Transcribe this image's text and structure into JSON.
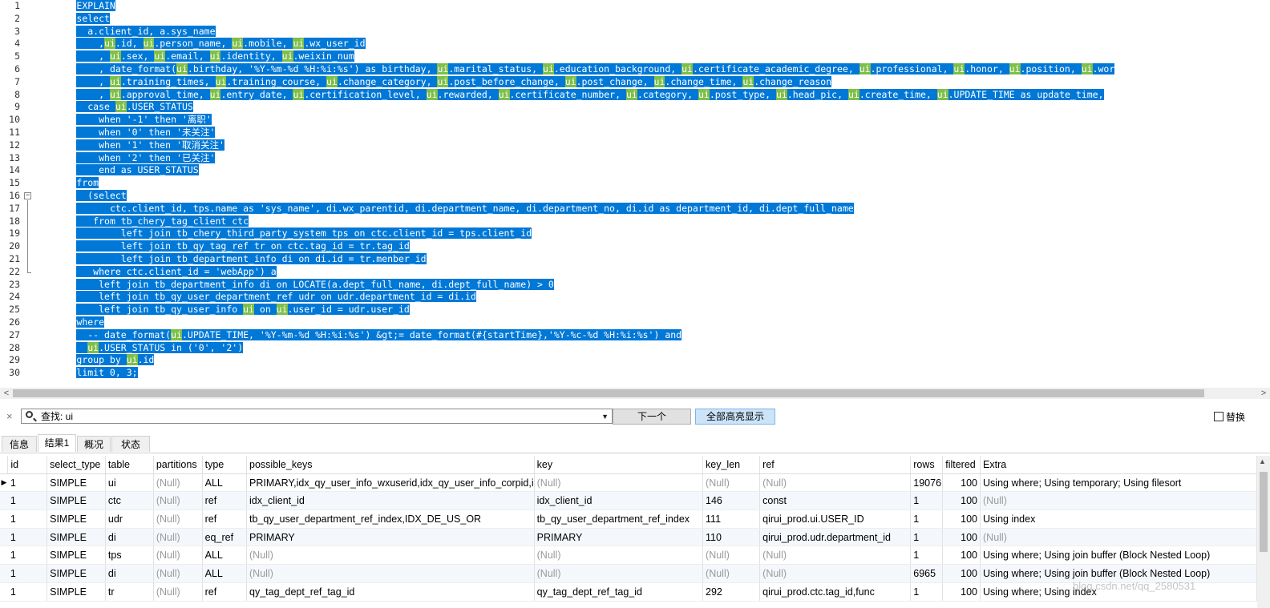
{
  "editor": {
    "line_numbers": [
      "1",
      "2",
      "3",
      "4",
      "5",
      "6",
      "7",
      "8",
      "9",
      "10",
      "11",
      "12",
      "13",
      "14",
      "15",
      "16",
      "17",
      "18",
      "19",
      "20",
      "21",
      "22",
      "23",
      "24",
      "25",
      "26",
      "27",
      "28",
      "29",
      "30"
    ],
    "fold_marker": "−",
    "lines": [
      [
        "        ",
        "EXPLAIN"
      ],
      [
        "        ",
        "select"
      ],
      [
        "          ",
        "a.client_id, a.sys_name"
      ],
      [
        "            ",
        ",",
        "ui",
        ".id, ",
        "ui",
        ".person_name, ",
        "ui",
        ".mobile, ",
        "ui",
        ".wx_user_id"
      ],
      [
        "            ",
        ", ",
        "ui",
        ".sex, ",
        "ui",
        ".email, ",
        "ui",
        ".identity, ",
        "ui",
        ".weixin_num"
      ],
      [
        "            ",
        ", date_format(",
        "ui",
        ".birthday, '%Y-%m-%d %H:%i:%s') as birthday, ",
        "ui",
        ".marital_status, ",
        "ui",
        ".education_background, ",
        "ui",
        ".certificate_academic_degree, ",
        "ui",
        ".professional, ",
        "ui",
        ".honor, ",
        "ui",
        ".position, ",
        "ui",
        ".wor"
      ],
      [
        "            ",
        ", ",
        "ui",
        ".training_times, ",
        "ui",
        ".training_course, ",
        "ui",
        ".change_category, ",
        "ui",
        ".post_before_change, ",
        "ui",
        ".post_change, ",
        "ui",
        ".change_time, ",
        "ui",
        ".change_reason"
      ],
      [
        "            ",
        ", ",
        "ui",
        ".approval_time, ",
        "ui",
        ".entry_date, ",
        "ui",
        ".certification_level, ",
        "ui",
        ".rewarded, ",
        "ui",
        ".certificate_number, ",
        "ui",
        ".category, ",
        "ui",
        ".post_type, ",
        "ui",
        ".head_pic, ",
        "ui",
        ".create_time, ",
        "ui",
        ".UPDATE_TIME as update_time,"
      ],
      [
        "          ",
        "case ",
        "ui",
        ".USER_STATUS"
      ],
      [
        "            ",
        "when '-1' then '离职'"
      ],
      [
        "            ",
        "when '0' then '未关注'"
      ],
      [
        "            ",
        "when '1' then '取消关注'"
      ],
      [
        "            ",
        "when '2' then '已关注'"
      ],
      [
        "            ",
        "end as USER_STATUS"
      ],
      [
        "        ",
        "from"
      ],
      [
        "          ",
        "(select"
      ],
      [
        "              ",
        "ctc.client_id, tps.name as 'sys_name', di.wx_parentid, di.department_name, di.department_no, di.id as department_id, di.dept_full_name"
      ],
      [
        "           ",
        "from tb_chery_tag_client ctc"
      ],
      [
        "                ",
        "left join tb_chery_third_party_system tps on ctc.client_id = tps.client_id"
      ],
      [
        "                ",
        "left join tb_qy_tag_ref tr on ctc.tag_id = tr.tag_id"
      ],
      [
        "                ",
        "left join tb_department_info di on di.id = tr.menber_id"
      ],
      [
        "           ",
        "where ctc.client_id = 'webApp') a"
      ],
      [
        "            ",
        "left join tb_department_info di on LOCATE(a.dept_full_name, di.dept_full_name) > 0"
      ],
      [
        "            ",
        "left join tb_qy_user_department_ref udr on udr.department_id = di.id"
      ],
      [
        "            ",
        "left join tb_qy_user_info ",
        "ui",
        " on ",
        "ui",
        ".user_id = udr.user_id"
      ],
      [
        "        ",
        "where"
      ],
      [
        "          ",
        "-- date_format(",
        "ui",
        ".UPDATE_TIME, '%Y-%m-%d %H:%i:%s') &gt;= date_format(#{startTime},'%Y-%c-%d %H:%i:%s') and"
      ],
      [
        "          ",
        "ui",
        ".USER_STATUS in ('0', '2')"
      ],
      [
        "        ",
        "group by ",
        "ui",
        ".id"
      ],
      [
        "        ",
        "limit 0, 3;"
      ]
    ]
  },
  "scrollbar": {
    "left_arrow": "<",
    "right_arrow": ">"
  },
  "findbar": {
    "close": "×",
    "label": "查找: ui",
    "dropdown_arrow": "▼",
    "next_label": "下一个",
    "highlight_all_label": "全部高亮显示",
    "replace_label": "替换",
    "icon": "search-icon"
  },
  "tabs": [
    "信息",
    "结果1",
    "概况",
    "状态"
  ],
  "results": {
    "columns": [
      "id",
      "select_type",
      "table",
      "partitions",
      "type",
      "possible_keys",
      "key",
      "key_len",
      "ref",
      "rows",
      "filtered",
      "Extra"
    ],
    "rows": [
      [
        "1",
        "SIMPLE",
        "ui",
        "(Null)",
        "ALL",
        "PRIMARY,idx_qy_user_info_wxuserid,idx_qy_user_info_corpid,i",
        "(Null)",
        "(Null)",
        "(Null)",
        "19076",
        "100",
        "Using where; Using temporary; Using filesort"
      ],
      [
        "1",
        "SIMPLE",
        "ctc",
        "(Null)",
        "ref",
        "idx_client_id",
        "idx_client_id",
        "146",
        "const",
        "1",
        "100",
        "(Null)"
      ],
      [
        "1",
        "SIMPLE",
        "udr",
        "(Null)",
        "ref",
        "tb_qy_user_department_ref_index,IDX_DE_US_OR",
        "tb_qy_user_department_ref_index",
        "111",
        "qirui_prod.ui.USER_ID",
        "1",
        "100",
        "Using index"
      ],
      [
        "1",
        "SIMPLE",
        "di",
        "(Null)",
        "eq_ref",
        "PRIMARY",
        "PRIMARY",
        "110",
        "qirui_prod.udr.department_id",
        "1",
        "100",
        "(Null)"
      ],
      [
        "1",
        "SIMPLE",
        "tps",
        "(Null)",
        "ALL",
        "(Null)",
        "(Null)",
        "(Null)",
        "(Null)",
        "1",
        "100",
        "Using where; Using join buffer (Block Nested Loop)"
      ],
      [
        "1",
        "SIMPLE",
        "di",
        "(Null)",
        "ALL",
        "(Null)",
        "(Null)",
        "(Null)",
        "(Null)",
        "6965",
        "100",
        "Using where; Using join buffer (Block Nested Loop)"
      ],
      [
        "1",
        "SIMPLE",
        "tr",
        "(Null)",
        "ref",
        "qy_tag_dept_ref_tag_id",
        "qy_tag_dept_ref_tag_id",
        "292",
        "qirui_prod.ctc.tag_id,func",
        "1",
        "100",
        "Using where; Using index"
      ]
    ],
    "current_row_marker": "▶"
  },
  "watermark": "blog.csdn.net/qq_2580531",
  "colors": {
    "selection": "#0078d7",
    "match_highlight": "#7dbf4a",
    "null_text": "#9a9a9a"
  }
}
